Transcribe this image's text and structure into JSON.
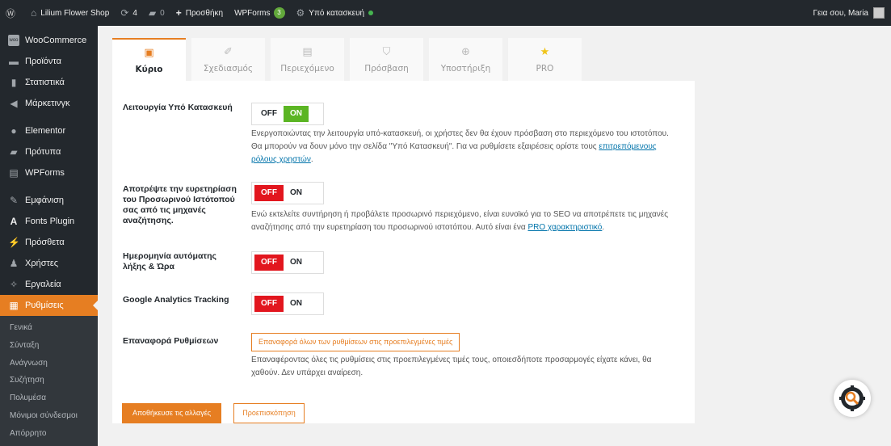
{
  "adminbar": {
    "site_name": "Lilium Flower Shop",
    "updates_count": "4",
    "comments_count": "0",
    "new_label": "Προσθήκη",
    "wpforms_label": "WPForms",
    "wpforms_count": "3",
    "maintenance_label": "Υπό κατασκευή",
    "greeting": "Γεια σου, Maria"
  },
  "sidebar": {
    "items": [
      {
        "label": "WooCommerce",
        "icon": "woocommerce-icon"
      },
      {
        "label": "Προϊόντα",
        "icon": "products-icon"
      },
      {
        "label": "Στατιστικά",
        "icon": "analytics-icon"
      },
      {
        "label": "Μάρκετινγκ",
        "icon": "megaphone-icon"
      },
      {
        "label": "Elementor",
        "icon": "elementor-icon"
      },
      {
        "label": "Πρότυπα",
        "icon": "folder-icon"
      },
      {
        "label": "WPForms",
        "icon": "wpforms-icon"
      },
      {
        "label": "Εμφάνιση",
        "icon": "paintbrush-icon"
      },
      {
        "label": "Fonts Plugin",
        "icon": "fonts-icon"
      },
      {
        "label": "Πρόσθετα",
        "icon": "plugin-icon"
      },
      {
        "label": "Χρήστες",
        "icon": "users-icon"
      },
      {
        "label": "Εργαλεία",
        "icon": "wrench-icon"
      },
      {
        "label": "Ρυθμίσεις",
        "icon": "settings-icon"
      }
    ],
    "submenu": [
      "Γενικά",
      "Σύνταξη",
      "Ανάγνωση",
      "Συζήτηση",
      "Πολυμέσα",
      "Μόνιμοι σύνδεσμοι",
      "Απόρρητο"
    ]
  },
  "tabs": [
    {
      "label": "Κύριο",
      "icon": "general-icon"
    },
    {
      "label": "Σχεδιασμός",
      "icon": "brush-icon"
    },
    {
      "label": "Περιεχόμενο",
      "icon": "content-icon"
    },
    {
      "label": "Πρόσβαση",
      "icon": "shield-icon"
    },
    {
      "label": "Υποστήριξη",
      "icon": "support-icon"
    },
    {
      "label": "PRO",
      "icon": "star-icon"
    }
  ],
  "toggle_labels": {
    "off": "OFF",
    "on": "ON"
  },
  "settings": {
    "maintenance": {
      "label": "Λειτουργία Υπό Κατασκευή",
      "state": "on",
      "desc": "Ενεργοποιώντας την λειτουργία υπό-κατασκευή, οι χρήστες δεν θα έχουν πρόσβαση στο περιεχόμενο του ιστοτόπου. Θα μπορούν να δουν μόνο την σελίδα \"Υπό Κατασκευή\". Για να ρυθμίσετε εξαιρέσεις ορίστε τους",
      "link": "επιτρεπόμενους ρόλους χρηστών",
      "desc_end": "."
    },
    "noindex": {
      "label": "Αποτρέψτε την ευρετηρίαση του Προσωρινού Ιστότοπού σας από τις μηχανές αναζήτησης.",
      "state": "off",
      "desc": "Ενώ εκτελείτε συντήρηση ή προβάλετε προσωρινό περιεχόμενο, είναι ευνοϊκό για το SEO να αποτρέπετε τις μηχανές αναζήτησης από την ευρετηρίαση του προσωρινού ιστοτόπου. Αυτό είναι ένα",
      "link": "PRO χαρακτηριστικό",
      "desc_end": "."
    },
    "auto_end": {
      "label": "Ημερομηνία αυτόματης λήξης & Ώρα",
      "state": "off"
    },
    "analytics": {
      "label": "Google Analytics Tracking",
      "state": "off"
    },
    "reset": {
      "label": "Επαναφορά Ρυθμίσεων",
      "button": "Επαναφορά όλων των ρυθμίσεων στις προεπιλεγμένες τιμές",
      "desc": "Επαναφέροντας όλες τις ρυθμίσεις στις προεπιλεγμένες τιμές τους, οποιεσδήποτε προσαρμογές είχατε κάνει, θα χαθούν. Δεν υπάρχει αναίρεση."
    }
  },
  "buttons": {
    "save": "Αποθήκευσε τις αλλαγές",
    "preview": "Προεπισκόπηση"
  },
  "colors": {
    "accent": "#e67e22",
    "on": "#5bb523",
    "off": "#e2161e"
  }
}
